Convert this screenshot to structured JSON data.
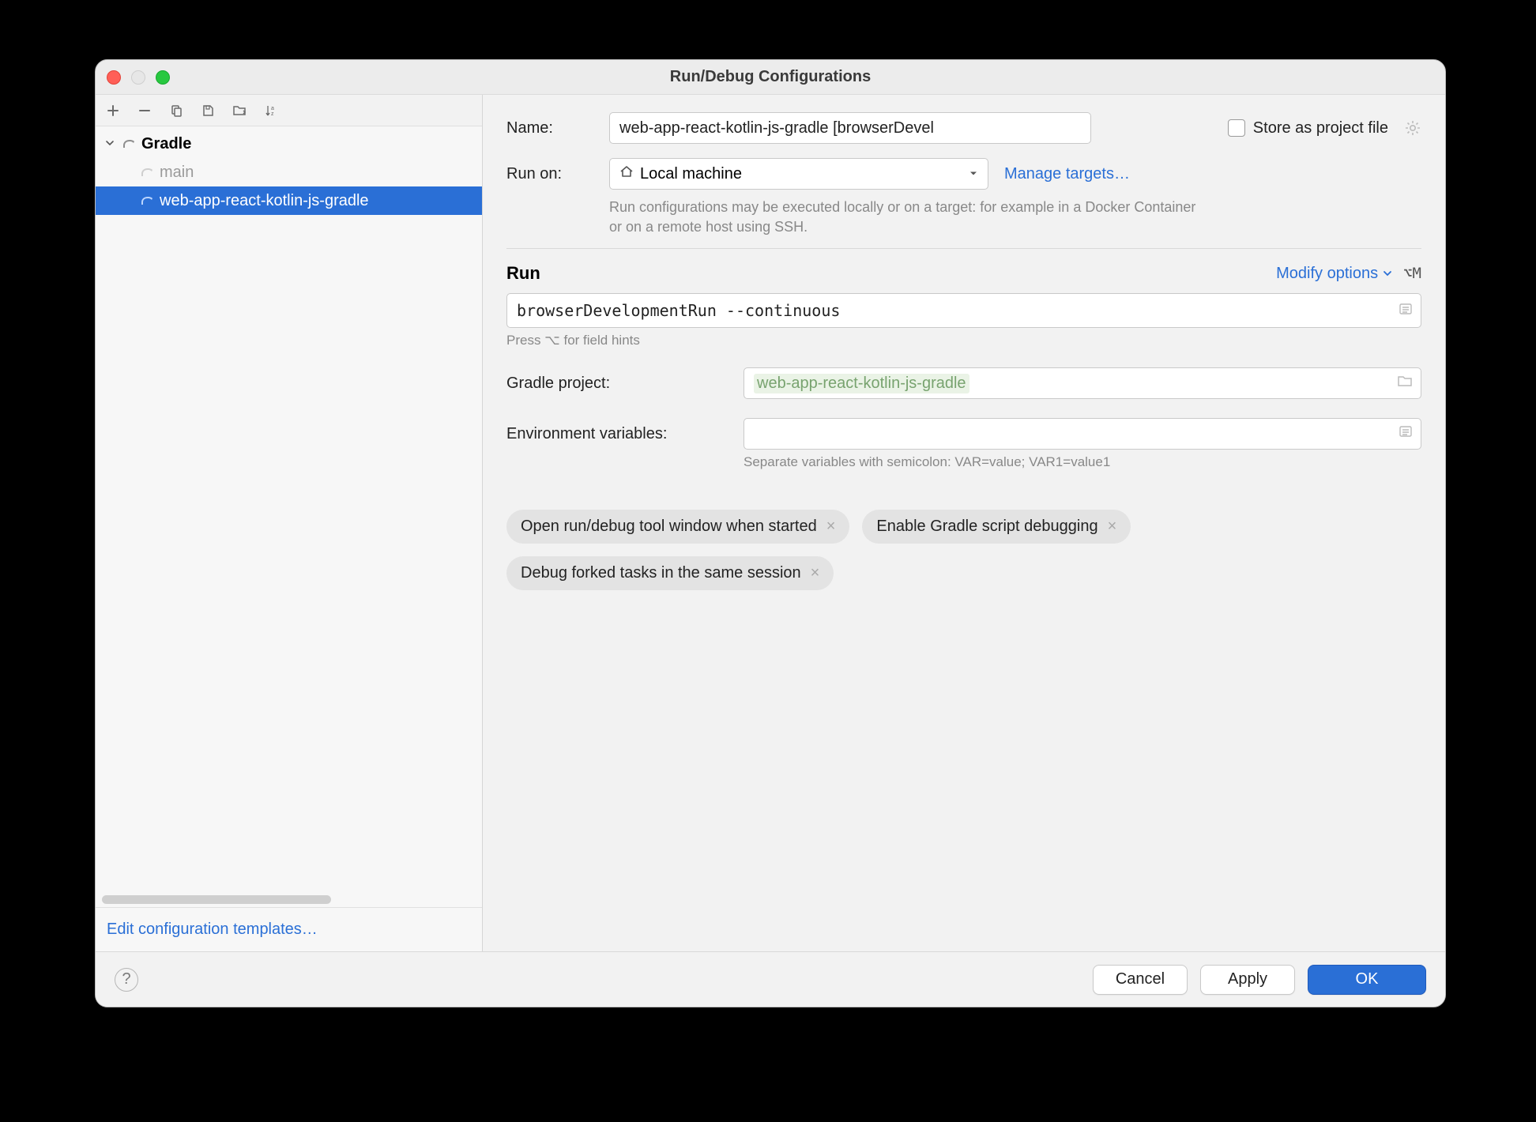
{
  "window": {
    "title": "Run/Debug Configurations"
  },
  "sidebar": {
    "root": {
      "label": "Gradle"
    },
    "items": [
      {
        "label": "main"
      },
      {
        "label": "web-app-react-kotlin-js-gradle"
      }
    ],
    "edit_templates": "Edit configuration templates…"
  },
  "form": {
    "name_label": "Name:",
    "name_value": "web-app-react-kotlin-js-gradle [browserDevel",
    "store_as_project_file": "Store as project file",
    "run_on_label": "Run on:",
    "run_on_value": "Local machine",
    "manage_targets": "Manage targets…",
    "run_on_help": "Run configurations may be executed locally or on a target: for example in a Docker Container or on a remote host using SSH."
  },
  "run": {
    "heading": "Run",
    "modify_options": "Modify options",
    "modify_shortcut": "⌥M",
    "tasks_value": "browserDevelopmentRun --continuous",
    "tasks_hint": "Press ⌥ for field hints",
    "gradle_project_label": "Gradle project:",
    "gradle_project_value": "web-app-react-kotlin-js-gradle",
    "env_label": "Environment variables:",
    "env_value": "",
    "env_hint": "Separate variables with semicolon: VAR=value; VAR1=value1"
  },
  "chips": [
    "Open run/debug tool window when started",
    "Enable Gradle script debugging",
    "Debug forked tasks in the same session"
  ],
  "buttons": {
    "cancel": "Cancel",
    "apply": "Apply",
    "ok": "OK"
  }
}
